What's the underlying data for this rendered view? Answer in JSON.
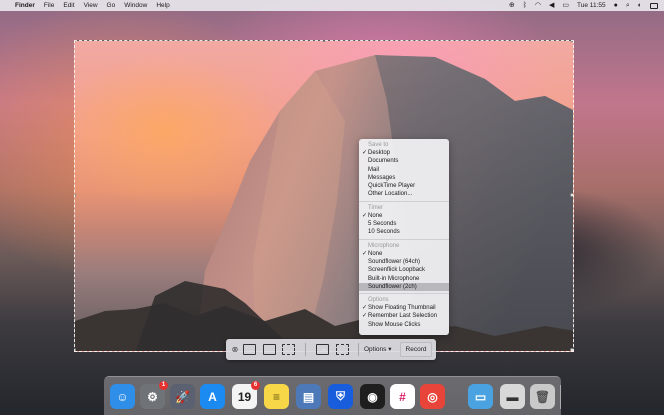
{
  "menubar": {
    "app": "Finder",
    "items": [
      "File",
      "Edit",
      "View",
      "Go",
      "Window",
      "Help"
    ],
    "clock": "Tue 11:55",
    "status_icons": [
      "globe-icon",
      "bluetooth-icon",
      "wifi-icon",
      "volume-icon",
      "battery-icon",
      "user-icon",
      "search-icon",
      "siri-icon",
      "control-center-icon"
    ]
  },
  "menu": {
    "sections": [
      {
        "header": "Save to",
        "items": [
          {
            "label": "Desktop",
            "checked": true
          },
          {
            "label": "Documents",
            "checked": false
          },
          {
            "label": "Mail",
            "checked": false
          },
          {
            "label": "Messages",
            "checked": false
          },
          {
            "label": "QuickTime Player",
            "checked": false
          },
          {
            "label": "Other Location...",
            "checked": false
          }
        ]
      },
      {
        "header": "Timer",
        "items": [
          {
            "label": "None",
            "checked": true
          },
          {
            "label": "5 Seconds",
            "checked": false
          },
          {
            "label": "10 Seconds",
            "checked": false
          }
        ]
      },
      {
        "header": "Microphone",
        "items": [
          {
            "label": "None",
            "checked": true
          },
          {
            "label": "Soundflower (64ch)",
            "checked": false
          },
          {
            "label": "Screenflick Loopback",
            "checked": false
          },
          {
            "label": "Built-in Microphone",
            "checked": false
          },
          {
            "label": "Soundflower (2ch)",
            "checked": false,
            "highlighted": true
          }
        ]
      },
      {
        "header": "Options",
        "items": [
          {
            "label": "Show Floating Thumbnail",
            "checked": true
          },
          {
            "label": "Remember Last Selection",
            "checked": true
          },
          {
            "label": "Show Mouse Clicks",
            "checked": false
          }
        ]
      }
    ]
  },
  "toolbar": {
    "options_label": "Options",
    "record_label": "Record"
  },
  "dock": {
    "icons": [
      {
        "name": "finder-icon",
        "color": "#2f8fe8",
        "glyph": "☺"
      },
      {
        "name": "system-preferences-icon",
        "color": "#6f7378",
        "glyph": "⚙",
        "badge": "1"
      },
      {
        "name": "launchpad-icon",
        "color": "#5b6170",
        "glyph": "🚀"
      },
      {
        "name": "app-store-icon",
        "color": "#1b8bf2",
        "glyph": "A"
      },
      {
        "name": "calendar-icon",
        "color": "#f4f4f4",
        "glyph": "19",
        "badge": "6",
        "text_color": "#222"
      },
      {
        "name": "notes-icon",
        "color": "#f7d748",
        "glyph": "≡",
        "text_color": "#6b5a12"
      },
      {
        "name": "preview-icon",
        "color": "#4d79b8",
        "glyph": "▤"
      },
      {
        "name": "bitwarden-icon",
        "color": "#175ddc",
        "glyph": "⛨"
      },
      {
        "name": "figma-icon",
        "color": "#1e1e1e",
        "glyph": "◉"
      },
      {
        "name": "slack-icon",
        "color": "#ffffff",
        "glyph": "#",
        "text_color": "#d8266b"
      },
      {
        "name": "chrome-icon",
        "color": "#e8443a",
        "glyph": "◎"
      },
      {
        "name": "downloads-folder-icon",
        "color": "#4aa3e0",
        "glyph": "▭"
      },
      {
        "name": "screenshot-stack-icon",
        "color": "#d8d8d8",
        "glyph": "▬",
        "text_color": "#333"
      },
      {
        "name": "trash-icon",
        "color": "#c9c9c9",
        "glyph": "🗑",
        "text_color": "#555"
      }
    ]
  }
}
